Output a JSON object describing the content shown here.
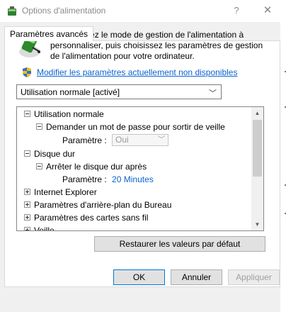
{
  "window": {
    "title": "Options d'alimentation",
    "help_glyph": "?",
    "close_glyph": "✕"
  },
  "tab": {
    "label": "Paramètres avancés"
  },
  "intro": {
    "text": "Sélectionnez le mode de gestion de l'alimentation à personnaliser, puis choisissez les paramètres de gestion de l'alimentation pour votre ordinateur."
  },
  "modify_link": "Modifier les paramètres actuellement non disponibles",
  "plan_select": {
    "value": "Utilisation normale [activé]"
  },
  "tree": {
    "items": [
      {
        "label": "Utilisation normale",
        "expanded": true
      },
      {
        "label": "Demander un mot de passe pour sortir de veille",
        "expanded": true
      },
      {
        "param_label": "Paramètre :",
        "param_value": "Oui"
      },
      {
        "label": "Disque dur",
        "expanded": true
      },
      {
        "label": "Arrêter le disque dur après",
        "expanded": true
      },
      {
        "param_label": "Paramètre :",
        "param_value": "20 Minutes"
      },
      {
        "label": "Internet Explorer",
        "expanded": false
      },
      {
        "label": "Paramètres d'arrière-plan du Bureau",
        "expanded": false
      },
      {
        "label": "Paramètres des cartes sans fil",
        "expanded": false
      },
      {
        "label": "Veille",
        "expanded": false
      }
    ]
  },
  "restore_button": "Restaurer les valeurs par défaut",
  "buttons": {
    "ok": "OK",
    "cancel": "Annuler",
    "apply": "Appliquer"
  },
  "colors": {
    "link": "#0b63ce",
    "focus_border": "#0078d7"
  }
}
